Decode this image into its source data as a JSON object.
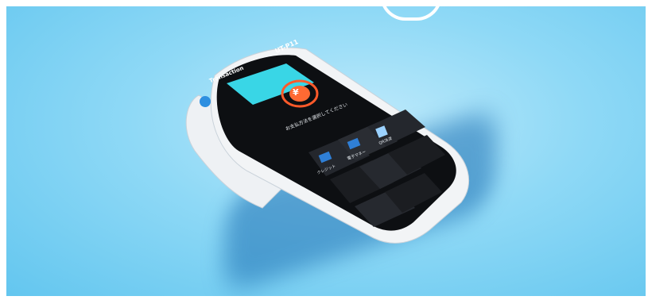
{
  "device": {
    "model": "UT-P11",
    "brand": "Transaction",
    "status_icons": "◎",
    "top_bar_text": "¥",
    "yen_symbol": "¥",
    "prompt": "お支払方法を選択してください",
    "options": [
      {
        "label": "クレジット",
        "icon": "card-icon"
      },
      {
        "label": "電子マネー",
        "icon": "emoney-icon"
      },
      {
        "label": "QR決済",
        "icon": "qr-icon"
      }
    ]
  },
  "colors": {
    "background": "#8fd9f6",
    "device_body": "#f2f4f6",
    "screen": "#111317",
    "accent_cyan": "#39d6e6",
    "yen_orange": "#ff5a2a"
  }
}
